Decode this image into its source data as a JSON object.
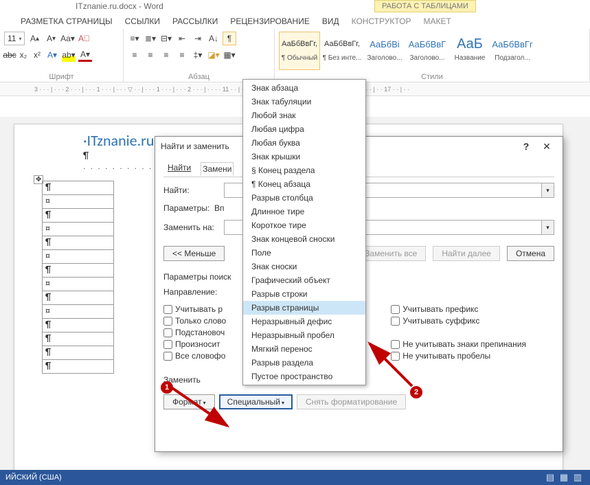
{
  "window": {
    "title": "ITznanie.ru.docx - Word",
    "table_tools": "РАБОТА С ТАБЛИЦАМИ"
  },
  "tabs": [
    "РАЗМЕТКА СТРАНИЦЫ",
    "ССЫЛКИ",
    "РАССЫЛКИ",
    "РЕЦЕНЗИРОВАНИЕ",
    "ВИД",
    "КОНСТРУКТОР",
    "МАКЕТ"
  ],
  "ribbon": {
    "font_size": "11",
    "group_font": "Шрифт",
    "group_para": "Абзац",
    "group_styles": "Стили",
    "styles": [
      {
        "sample": "АаБбВвГг,",
        "name": "¶ Обычный",
        "sel": true,
        "cls": ""
      },
      {
        "sample": "АаБбВвГг,",
        "name": "¶ Без инте...",
        "sel": false,
        "cls": ""
      },
      {
        "sample": "АаБбВі",
        "name": "Заголово...",
        "sel": false,
        "cls": "h"
      },
      {
        "sample": "АаБбВвГ",
        "name": "Заголово...",
        "sel": false,
        "cls": "h"
      },
      {
        "sample": "АаБ",
        "name": "Название",
        "sel": false,
        "cls": "hh"
      },
      {
        "sample": "АаБбВвГг",
        "name": "Подзагол...",
        "sel": false,
        "cls": "h"
      }
    ]
  },
  "ruler": "3 · · · | · · · 2 · · · | · · · 1 · · · | · · · ▽ · · | · · · 1 · · · | · · · 2 · · · | · · · ·                                                         11 · · | · · 12 · · | · · 13 · · | · · 14 · · | · · 15 · · | · · 16 · · | · · 17 · · | · ·",
  "doc": {
    "heading": "·ITznanie.ru→"
  },
  "dialog": {
    "title": "Найти и заменить",
    "tabs": {
      "find": "Найти",
      "replace": "Замени"
    },
    "find_label": "Найти:",
    "params_label": "Параметры:",
    "params_value": "Вп",
    "replace_label": "Заменить на:",
    "less": "<< Меньше",
    "replace_all": "Заменить все",
    "find_next": "Найти далее",
    "cancel": "Отмена",
    "search_params": "Параметры поиск",
    "direction": "Направление:",
    "chk": {
      "case": "Учитывать р",
      "whole": "Только слово",
      "wildcard": "Подстановоч",
      "sounds": "Произносит",
      "forms": "Все словофо",
      "prefix": "Учитывать префикс",
      "suffix": "Учитывать суффикс",
      "punct": "Не учитывать знаки препинания",
      "space": "Не учитывать пробелы"
    },
    "replace_section": "Заменить",
    "format_btn": "Формат",
    "special_btn": "Специальный",
    "unformat_btn": "Снять форматирование"
  },
  "menu": {
    "items": [
      "Знак абзаца",
      "Знак табуляции",
      "Любой знак",
      "Любая цифра",
      "Любая буква",
      "Знак крышки",
      "§ Конец раздела",
      "¶ Конец абзаца",
      "Разрыв столбца",
      "Длинное тире",
      "Короткое тире",
      "Знак концевой сноски",
      "Поле",
      "Знак сноски",
      "Графический объект",
      "Разрыв строки",
      "Разрыв страницы",
      "Неразрывный дефис",
      "Неразрывный пробел",
      "Мягкий перенос",
      "Разрыв раздела",
      "Пустое пространство"
    ],
    "hover_index": 16
  },
  "annotations": {
    "b1": "1",
    "b2": "2"
  },
  "status": {
    "lang": "ИЙСКИЙ (США)"
  }
}
